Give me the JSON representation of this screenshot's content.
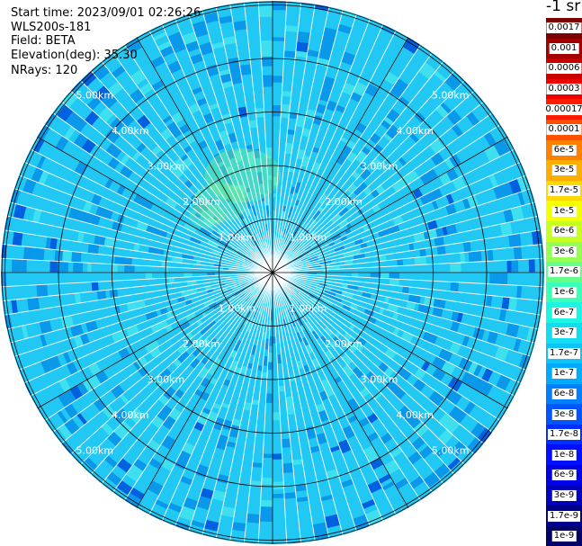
{
  "info": {
    "start_time": "Start time: 2023/09/01 02:26:26",
    "instrument": "WLS200s-181",
    "field": "Field: BETA",
    "elevation": "Elevation(deg): 35.30",
    "nrays": "NRays: 120"
  },
  "colorbar": {
    "unit": "-1 sr",
    "cells": [
      {
        "label": "0.0017",
        "color": "#7f0000"
      },
      {
        "label": "0.001",
        "color": "#a40000"
      },
      {
        "label": "0.0006",
        "color": "#c80000"
      },
      {
        "label": "0.0003",
        "color": "#ee0000"
      },
      {
        "label": "0.00017",
        "color": "#ff1a00"
      },
      {
        "label": "0.0001",
        "color": "#ff5000"
      },
      {
        "label": "6e-5",
        "color": "#ff8000"
      },
      {
        "label": "3e-5",
        "color": "#ffae00"
      },
      {
        "label": "1.7e-5",
        "color": "#ffd800"
      },
      {
        "label": "1e-5",
        "color": "#f4ff00"
      },
      {
        "label": "6e-6",
        "color": "#c8ff22"
      },
      {
        "label": "3e-6",
        "color": "#96ff55"
      },
      {
        "label": "1.7e-6",
        "color": "#66ff88"
      },
      {
        "label": "1e-6",
        "color": "#3cffb8"
      },
      {
        "label": "6e-7",
        "color": "#1ef4e4"
      },
      {
        "label": "3e-7",
        "color": "#12dcf0"
      },
      {
        "label": "1.7e-7",
        "color": "#0cc4f8"
      },
      {
        "label": "1e-7",
        "color": "#00aaff"
      },
      {
        "label": "6e-8",
        "color": "#0080ff"
      },
      {
        "label": "3e-8",
        "color": "#0055ff"
      },
      {
        "label": "1.7e-8",
        "color": "#0030ff"
      },
      {
        "label": "1e-8",
        "color": "#0010ff"
      },
      {
        "label": "6e-9",
        "color": "#0000e6"
      },
      {
        "label": "3e-9",
        "color": "#0000b8"
      },
      {
        "label": "1.7e-9",
        "color": "#00008c"
      },
      {
        "label": "1e-9",
        "color": "#000066"
      }
    ]
  },
  "ring_labels": [
    "1.00km",
    "2.00km",
    "3.00km",
    "4.00km",
    "5.00km"
  ],
  "colors": {
    "field_base": "#22c8f4",
    "field_light": "#3ee0f0",
    "field_dark": "#0a98ea",
    "field_deep": "#0060e0",
    "plume": "#90ff70",
    "ray_line": "#ffffff",
    "grid_line": "#000000",
    "ring_label": "#ffffff"
  }
}
